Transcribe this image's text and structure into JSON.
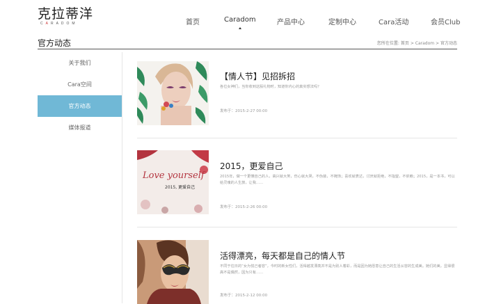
{
  "logo": {
    "cn": "克拉蒂洋",
    "en_pre": "C",
    "en_accent": "A",
    "en_post": "RADOM"
  },
  "nav": [
    {
      "label": "首页"
    },
    {
      "label": "Caradom"
    },
    {
      "label": "产品中心"
    },
    {
      "label": "定制中心"
    },
    {
      "label": "Cara活动"
    },
    {
      "label": "会员Club"
    }
  ],
  "page_title": "官方动态",
  "breadcrumb": {
    "prefix": "您所在位置:",
    "home": "首页",
    "sep": ">",
    "mid": "Caradom",
    "current": "官方动态"
  },
  "sidebar": [
    {
      "label": "关于我们"
    },
    {
      "label": "Cara空间"
    },
    {
      "label": "官方动态"
    },
    {
      "label": "媒体报道"
    }
  ],
  "news": [
    {
      "title": "【情人节】见招拆招",
      "summary": "各位女神们，当你收到这股礼物时，知道你内心的真实想法吗？",
      "date": "发布于：2015-2-27 00:00"
    },
    {
      "title": "2015，更爱自己",
      "summary": "2015年，做一个更懂自己的人，高兴就大笑，伤心就大哭，不伪装，不掩饰；喜欢就表达，讨厌就拒绝，不指望，不依赖；2015，是一本书，可以给灵魂的人生旅，让我……",
      "date": "发布于：2015-2-26 00:00",
      "image_text": {
        "line1": "Love yourself",
        "line2": "2015, 更爱自己"
      }
    },
    {
      "title": "活得漂亮，每天都是自己的情人节",
      "summary": "不同于往日的“女为悦己者容”，今时的新女性们，活得越发漂亮并不是为别人着彩，而是因为她愿意让自己的生活从容的生成美。她们的美，显得很高不是偶然，因为只有……",
      "date": "发布于：2015-2-12 00:00"
    }
  ],
  "colors": {
    "accent": "#70b8d6",
    "divider": "#e5e5e5"
  }
}
